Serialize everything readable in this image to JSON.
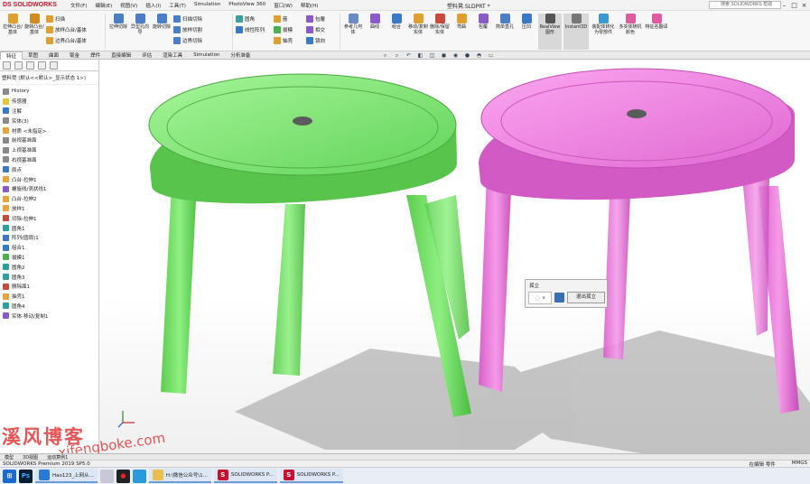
{
  "app": {
    "logo": "DS SOLIDWORKS",
    "menu": [
      "文件(F)",
      "编辑(E)",
      "视图(V)",
      "插入(I)",
      "工具(T)",
      "Simulation",
      "PhotoView 360",
      "窗口(W)",
      "帮助(H)"
    ],
    "doc_title": "塑料凳.SLDPRT *",
    "search_placeholder": "搜索 SOLIDWORKS 帮助"
  },
  "ribbon": {
    "features": [
      {
        "label": "拉伸凸台/基体",
        "icon": "extrude-boss-icon"
      },
      {
        "label": "旋转凸台/基体",
        "icon": "revolve-boss-icon"
      }
    ],
    "rows_a": [
      "扫描",
      "放样凸台/基体",
      "边界凸台/基体"
    ],
    "cuts": [
      {
        "label": "拉伸切除",
        "icon": "extrude-cut-icon"
      },
      {
        "label": "异型孔向导",
        "icon": "hole-wizard-icon"
      },
      {
        "label": "旋转切除",
        "icon": "revolve-cut-icon"
      }
    ],
    "rows_b": [
      "扫描切除",
      "放样切割",
      "边界切除"
    ],
    "rows_c": [
      "圆角",
      "线性阵列"
    ],
    "rows_d": [
      "筋",
      "拔模",
      "抽壳"
    ],
    "rows_e": [
      "包覆",
      "相交",
      "镜向"
    ],
    "tools": [
      {
        "label": "参考几何体",
        "icon": "reference-geometry-icon"
      },
      {
        "label": "曲线",
        "icon": "curves-icon"
      },
      {
        "label": "组合",
        "icon": "combine-icon"
      },
      {
        "label": "移动/复制实体",
        "icon": "move-copy-icon"
      },
      {
        "label": "删除/保留实体",
        "icon": "delete-body-icon"
      },
      {
        "label": "弯曲",
        "icon": "flex-icon"
      },
      {
        "label": "包覆",
        "icon": "wrap-icon"
      },
      {
        "label": "简单直孔",
        "icon": "simple-hole-icon"
      },
      {
        "label": "压凹",
        "icon": "indent-icon"
      },
      {
        "label": "RealView图形",
        "icon": "realview-icon"
      },
      {
        "label": "Instant3D",
        "icon": "instant3d-icon"
      },
      {
        "label": "装配体转化为零部件",
        "icon": "convert-icon"
      },
      {
        "label": "多实体随机颜色",
        "icon": "random-color-icon"
      },
      {
        "label": "特征名翻译",
        "icon": "translate-icon"
      }
    ]
  },
  "tabs": [
    "特征",
    "草图",
    "曲面",
    "钣金",
    "焊件",
    "直接编辑",
    "评估",
    "渲染工具",
    "Simulation",
    "分析准备"
  ],
  "tree": {
    "root": "塑料凳 (默认<<默认>_显示状态 1>)",
    "items": [
      {
        "label": "History",
        "color": "grey"
      },
      {
        "label": "传感器",
        "color": "yellow"
      },
      {
        "label": "注解",
        "color": "blue"
      },
      {
        "label": "实体(3)",
        "color": "grey"
      },
      {
        "label": "材质 <未指定>",
        "color": "orange"
      },
      {
        "label": "前视基准面",
        "color": "grey"
      },
      {
        "label": "上视基准面",
        "color": "grey"
      },
      {
        "label": "右视基准面",
        "color": "grey"
      },
      {
        "label": "原点",
        "color": "blue"
      },
      {
        "label": "凸台-拉伸1",
        "color": "orange"
      },
      {
        "label": "螺旋线/涡状线1",
        "color": "purple"
      },
      {
        "label": "凸台-拉伸2",
        "color": "orange"
      },
      {
        "label": "放样1",
        "color": "orange"
      },
      {
        "label": "切除-拉伸1",
        "color": "red"
      },
      {
        "label": "圆角1",
        "color": "teal"
      },
      {
        "label": "阵列(圆周)1",
        "color": "blue"
      },
      {
        "label": "组合1",
        "color": "blue"
      },
      {
        "label": "拔模1",
        "color": "green"
      },
      {
        "label": "圆角2",
        "color": "teal"
      },
      {
        "label": "圆角3",
        "color": "teal"
      },
      {
        "label": "删除面1",
        "color": "red"
      },
      {
        "label": "抽壳1",
        "color": "orange"
      },
      {
        "label": "圆角4",
        "color": "teal"
      },
      {
        "label": "实体-移动/复制1",
        "color": "purple"
      }
    ]
  },
  "popup": {
    "title": "孤立",
    "exit_label": "退出孤立"
  },
  "watermark": {
    "line1": "溪风博客",
    "line2": "xifengboke.com"
  },
  "bottom_tabs": [
    "模型",
    "3D视图",
    "运动算例1"
  ],
  "status": {
    "left": "SOLIDWORKS Premium 2019 SP5.0",
    "editing": "在编辑 零件",
    "units": "MMGS"
  },
  "taskbar": [
    {
      "label": "Hao123_上网从...",
      "icon": "browser-icon"
    },
    {
      "label": "H:\\微信公众号\\1...",
      "icon": "folder-icon"
    },
    {
      "label": "SOLIDWORKS P...",
      "icon": "solidworks-icon"
    },
    {
      "label": "SOLIDWORKS P...",
      "icon": "solidworks-icon"
    }
  ],
  "colors": {
    "stool_green": "#7ee86e",
    "stool_pink": "#ee7fe0",
    "accent": "#c8102e"
  }
}
